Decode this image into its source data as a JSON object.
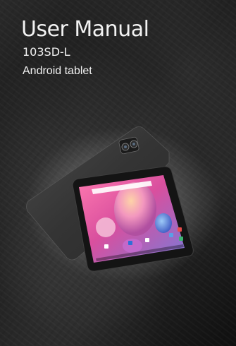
{
  "cover": {
    "title": "User Manual",
    "model": "103SD-L",
    "subtitle": "Android tablet"
  },
  "colors": {
    "background": "#1c1c1c",
    "text": "#f2f2f2",
    "tablet_back": "#3b3b3b",
    "screen_pink": "#e25aa8",
    "screen_blue": "#5aa0e6"
  },
  "image": {
    "subject": "tablet-front-and-back-render"
  }
}
